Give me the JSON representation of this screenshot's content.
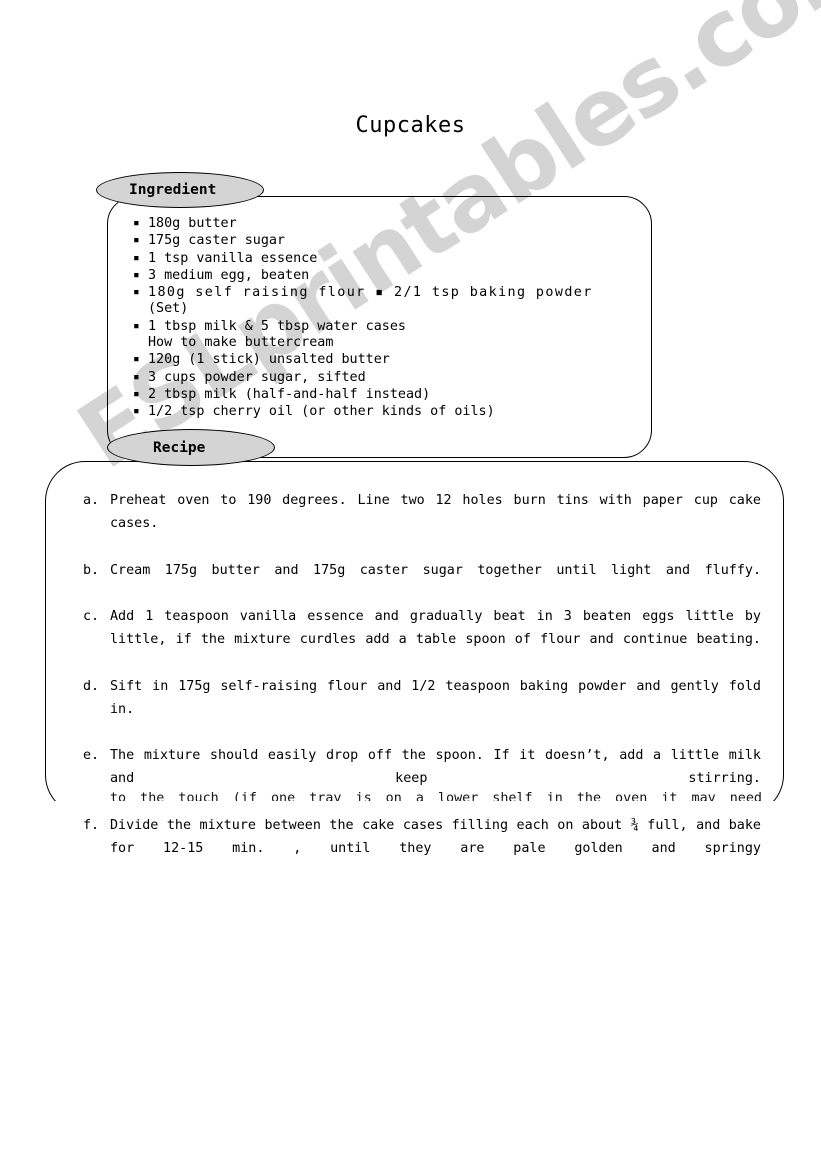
{
  "document": {
    "title": "Cupcakes"
  },
  "watermark": {
    "text": "ESLprintables.com",
    "color": "#d4d4d4"
  },
  "sections": {
    "ingredient": {
      "tab_label": "Ingredient",
      "tab_color": "#d4d4d4",
      "items": [
        {
          "bullet": true,
          "text": "180g butter"
        },
        {
          "bullet": true,
          "text": "175g caster sugar"
        },
        {
          "bullet": true,
          "text": "1 tsp vanilla essence"
        },
        {
          "bullet": true,
          "text": "3 medium egg, beaten"
        },
        {
          "bullet": true,
          "text": "180g self raising flour ▪ 2/1 tsp baking powder"
        },
        {
          "bullet": false,
          "text": "(Set)"
        },
        {
          "bullet": true,
          "text": "1 tbsp milk & 5 tbsp water cases"
        },
        {
          "bullet": false,
          "text": "How to make buttercream"
        },
        {
          "bullet": true,
          "text": "120g (1 stick) unsalted butter"
        },
        {
          "bullet": true,
          "text": "3 cups powder sugar, sifted"
        },
        {
          "bullet": true,
          "text": "2 tbsp milk (half-and-half instead)"
        },
        {
          "bullet": true,
          "text": "1/2 tsp cherry oil (or other kinds of oils)"
        }
      ]
    },
    "recipe": {
      "tab_label": "Recipe",
      "tab_color": "#d4d4d4",
      "steps": [
        {
          "marker": "a.",
          "text": "Preheat oven to 190 degrees.  Line two 12 holes burn tins with paper cup cake cases."
        },
        {
          "marker": "b.",
          "text": "Cream 175g butter and 175g caster sugar together until light and fluffy."
        },
        {
          "marker": "c.",
          "text": "Add 1 teaspoon vanilla essence and gradually beat in 3 beaten eggs little by little, if the mixture curdles add a table spoon of flour and continue beating."
        },
        {
          "marker": "d.",
          "text": "Sift in 175g self-raising flour and 1/2 teaspoon baking powder and gently fold in."
        },
        {
          "marker": "e.",
          "text": "The mixture should easily drop off the spoon. If it doesn’t, add a little milk and keep stirring."
        },
        {
          "marker": "f.",
          "text": "Divide the mixture between the cake cases filling each on about ¾ full, and bake for 12-15 min. , until they are pale golden and springy"
        }
      ],
      "clipped_line": "to the touch (if one tray is on a lower shelf in the oven it may need"
    }
  }
}
